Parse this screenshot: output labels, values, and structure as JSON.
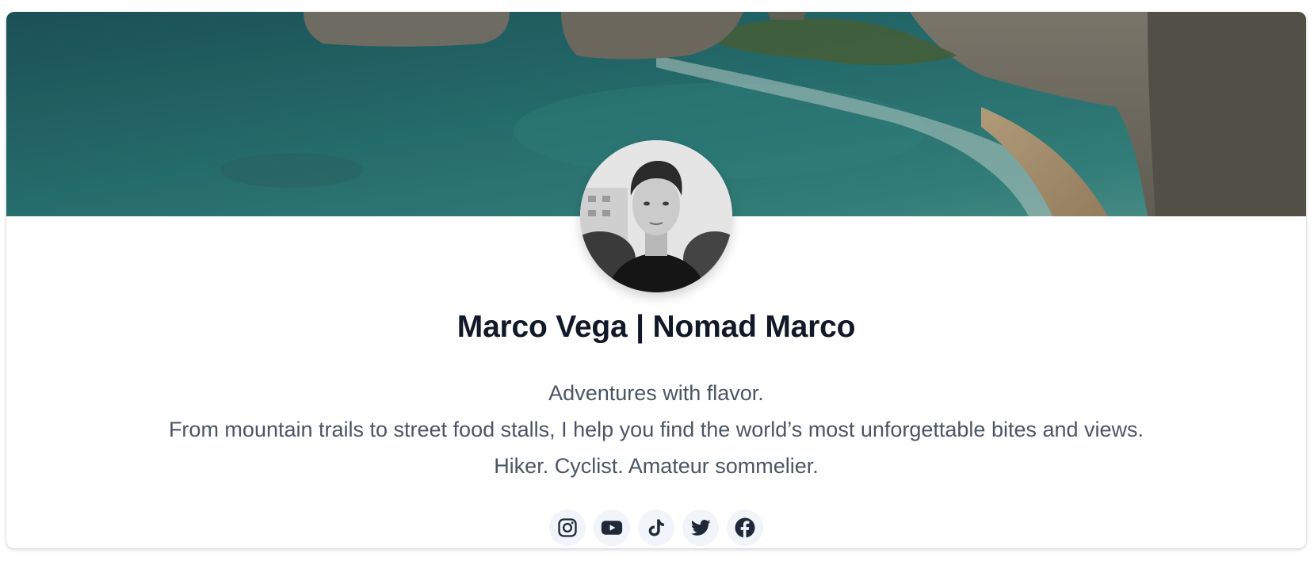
{
  "profile": {
    "name": "Marco Vega | Nomad Marco",
    "bio": [
      "Adventures with flavor.",
      "From mountain trails to street food stalls, I help you find the world’s most unforgettable bites and views.",
      "Hiker. Cyclist. Amateur sommelier."
    ]
  },
  "cover": {
    "icon": "coastal-cliffs-photo"
  },
  "avatar": {
    "icon": "profile-photo"
  },
  "social_links": [
    {
      "icon": "instagram-icon"
    },
    {
      "icon": "youtube-icon"
    },
    {
      "icon": "tiktok-icon"
    },
    {
      "icon": "twitter-icon"
    },
    {
      "icon": "facebook-icon"
    }
  ],
  "colors": {
    "name_text": "#111827",
    "bio_text": "#4b5563",
    "icon_bg": "#f1f5f9",
    "icon_fg": "#1f2937"
  }
}
